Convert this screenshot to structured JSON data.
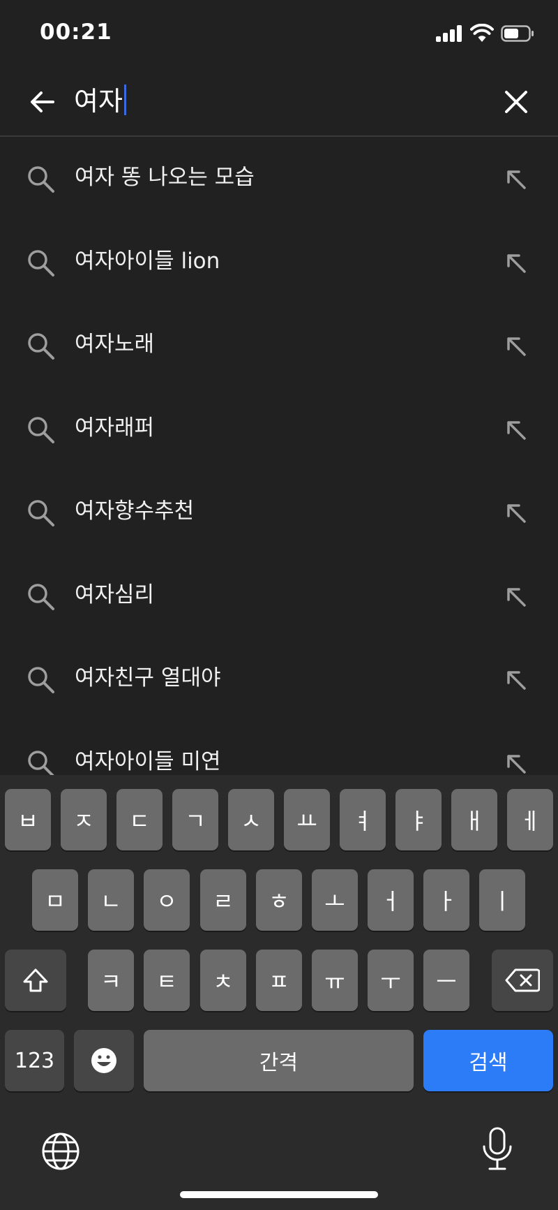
{
  "status_bar": {
    "time": "00:21"
  },
  "search": {
    "query": "여자"
  },
  "suggestions": [
    {
      "text": "여자 똥 나오는 모습"
    },
    {
      "text": "여자아이들 lion"
    },
    {
      "text": "여자노래"
    },
    {
      "text": "여자래퍼"
    },
    {
      "text": "여자향수추천"
    },
    {
      "text": "여자심리"
    },
    {
      "text": "여자친구 열대야"
    },
    {
      "text": "여자아이들 미연"
    }
  ],
  "keyboard": {
    "row1": [
      "ㅂ",
      "ㅈ",
      "ㄷ",
      "ㄱ",
      "ㅅ",
      "ㅛ",
      "ㅕ",
      "ㅑ",
      "ㅐ",
      "ㅔ"
    ],
    "row2": [
      "ㅁ",
      "ㄴ",
      "ㅇ",
      "ㄹ",
      "ㅎ",
      "ㅗ",
      "ㅓ",
      "ㅏ",
      "ㅣ"
    ],
    "row3": [
      "ㅋ",
      "ㅌ",
      "ㅊ",
      "ㅍ",
      "ㅠ",
      "ㅜ",
      "ㅡ"
    ],
    "numbers_label": "123",
    "space_label": "간격",
    "search_label": "검색",
    "icons": {
      "shift": "shift-icon",
      "delete": "backspace-icon",
      "emoji": "emoji-icon",
      "globe": "globe-icon",
      "mic": "microphone-icon"
    },
    "colors": {
      "accent": "#2b7cf6",
      "key": "#6b6b6b",
      "key_dark": "#464646"
    }
  }
}
